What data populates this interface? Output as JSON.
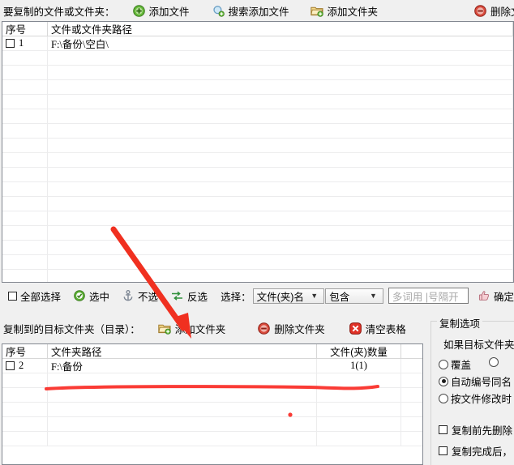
{
  "top_toolbar": {
    "label": "要复制的文件或文件夹：",
    "buttons": [
      {
        "name": "add-file",
        "icon": "green-plus-circle-icon",
        "label": "添加文件"
      },
      {
        "name": "search-add-file",
        "icon": "magnifier-plus-icon",
        "label": "搜索添加文件"
      },
      {
        "name": "add-folder",
        "icon": "folder-plus-icon",
        "label": "添加文件夹"
      },
      {
        "name": "delete-file",
        "icon": "red-minus-circle-icon",
        "label": "删除文"
      }
    ]
  },
  "source_table": {
    "headers": {
      "index": "序号",
      "path": "文件或文件夹路径"
    },
    "rows": [
      {
        "index": "1",
        "path": "F:\\备份\\空白\\",
        "checked": false
      }
    ],
    "empty_rows": 16
  },
  "select_bar": {
    "select_all_label": "全部选择",
    "selected_label": "选中",
    "unselected_label": "不选",
    "invert_label": "反选",
    "select_prefix": "选择：",
    "field_value": "文件(夹)名",
    "match_value": "包含",
    "keyword_placeholder": "多词用 |号隔开",
    "keyword_value": "",
    "confirm_label": "确定",
    "icons": {
      "selected": "green-check-circle-icon",
      "unselected": "anchor-icon",
      "invert": "swap-icon",
      "confirm": "thumb-up-icon"
    }
  },
  "target_toolbar": {
    "label": "复制到的目标文件夹（目录）：",
    "buttons": [
      {
        "name": "add-folder",
        "icon": "folder-plus-icon",
        "label": "添加文件夹"
      },
      {
        "name": "delete-folder",
        "icon": "red-minus-circle-icon",
        "label": "删除文件夹"
      },
      {
        "name": "clear-table",
        "icon": "red-x-circle-icon",
        "label": "清空表格"
      }
    ]
  },
  "target_table": {
    "headers": {
      "index": "序号",
      "path": "文件夹路径",
      "count": "文件(夹)数量"
    },
    "rows": [
      {
        "index": "2",
        "path": "F:\\备份",
        "count": "1(1)",
        "checked": false
      }
    ],
    "empty_rows": 5
  },
  "copy_options": {
    "title": "复制选项",
    "subtitle": "如果目标文件夹",
    "radios": [
      {
        "label": "覆盖",
        "selected": false
      },
      {
        "label": "自动编号同名",
        "selected": true
      },
      {
        "label": "按文件修改时",
        "selected": false
      }
    ],
    "checkboxes": [
      {
        "label": "复制前先删除",
        "checked": false
      },
      {
        "label": "复制完成后，",
        "checked": false
      }
    ]
  },
  "annotations": {
    "arrow_color": "#f03020",
    "underline_color": "#fa3b35",
    "dot_color": "#fa3b35"
  }
}
